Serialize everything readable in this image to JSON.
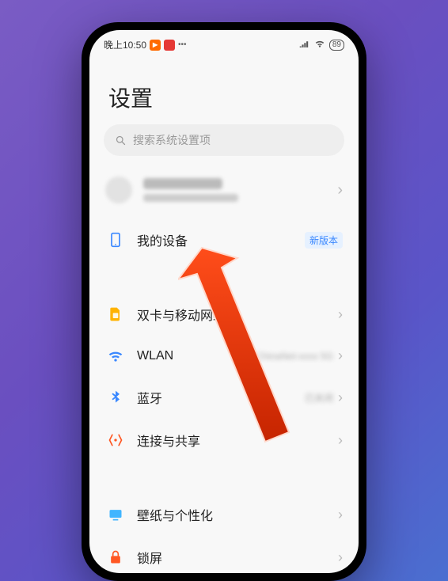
{
  "statusbar": {
    "time": "晚上10:50",
    "battery": "89"
  },
  "page": {
    "title": "设置"
  },
  "search": {
    "placeholder": "搜索系统设置项"
  },
  "account": {
    "name_blurred": true,
    "chevron": "›"
  },
  "items": {
    "device": {
      "label": "我的设备",
      "badge": "新版本",
      "icon": "device-icon"
    },
    "sim": {
      "label": "双卡与移动网络",
      "icon": "sim-icon"
    },
    "wlan": {
      "label": "WLAN",
      "icon": "wifi-icon"
    },
    "bluetooth": {
      "label": "蓝牙",
      "icon": "bluetooth-icon"
    },
    "share": {
      "label": "连接与共享",
      "icon": "share-icon"
    },
    "wallpaper": {
      "label": "壁纸与个性化",
      "icon": "wallpaper-icon"
    },
    "lock": {
      "label": "锁屏",
      "icon": "lock-icon"
    }
  },
  "chevron": "›"
}
